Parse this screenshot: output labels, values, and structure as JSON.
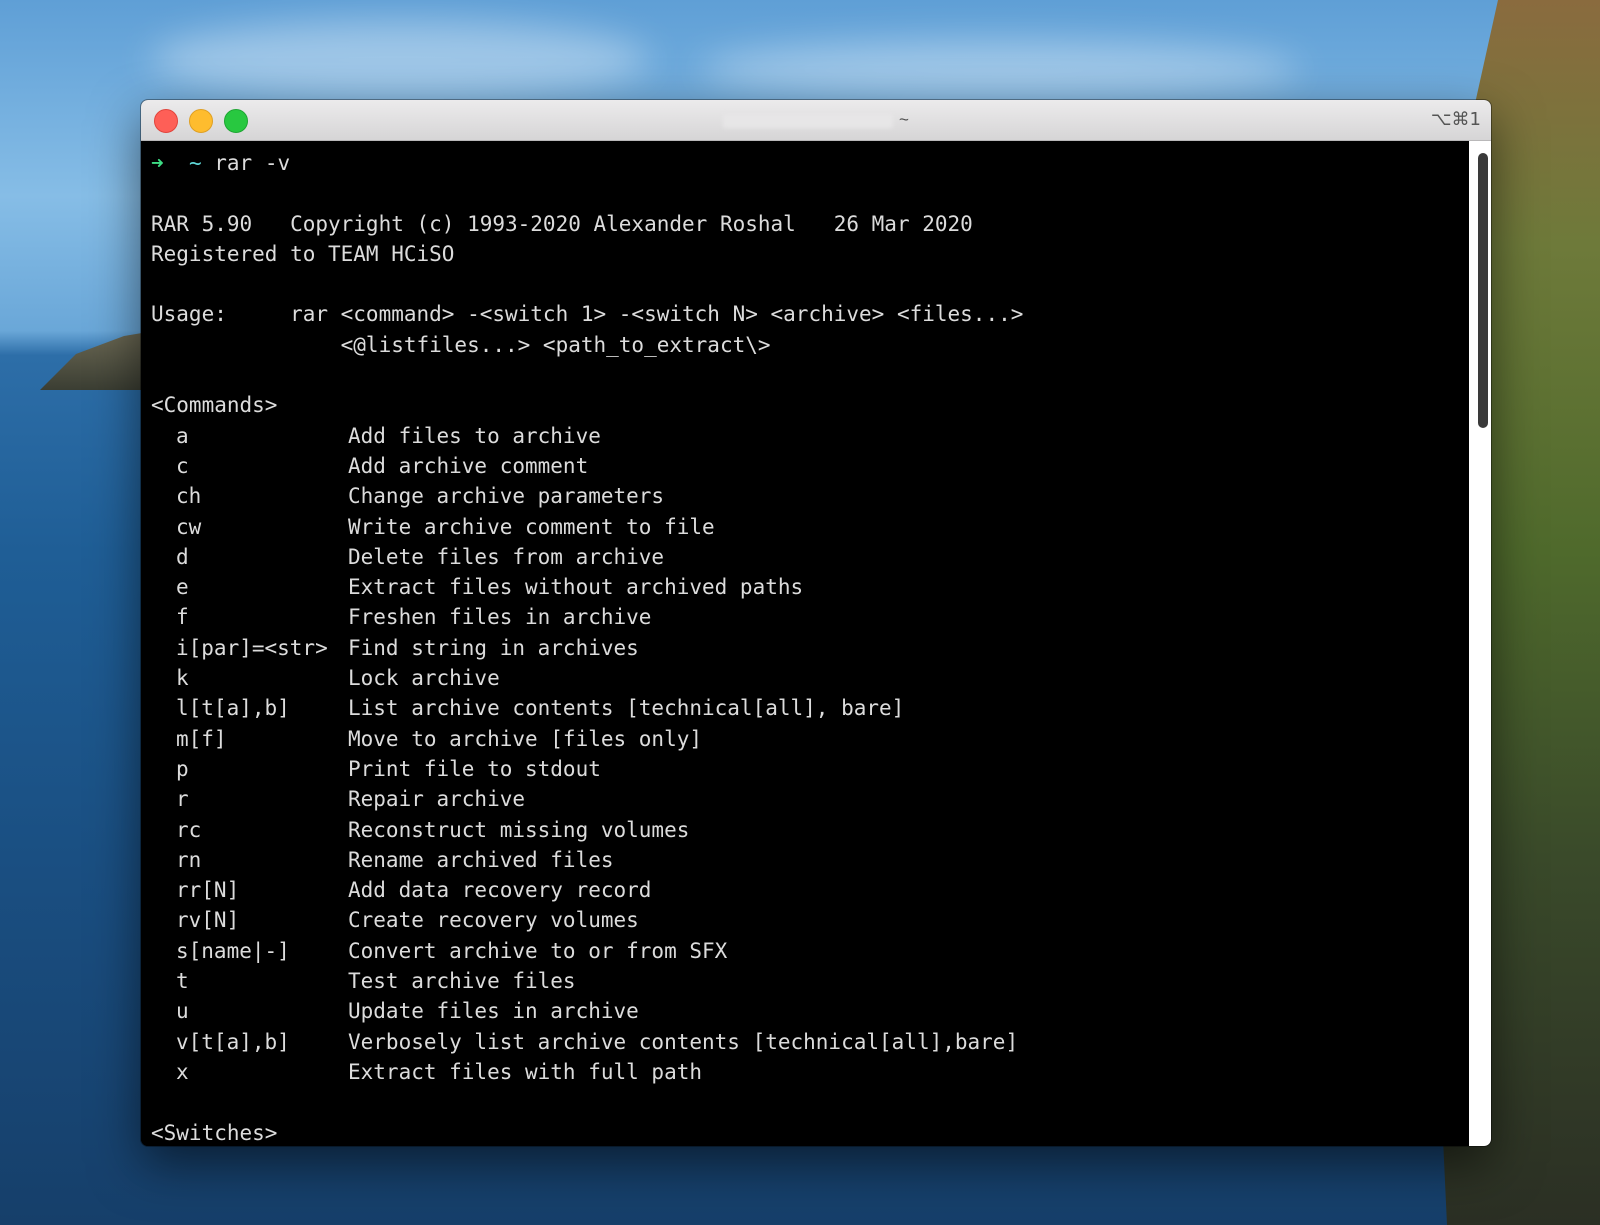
{
  "window": {
    "title_suffix": "~",
    "shortcut": "⌥⌘1"
  },
  "terminal": {
    "prompt": {
      "arrow": "➜",
      "dir": "~",
      "command": "rar -v"
    },
    "header": [
      "RAR 5.90   Copyright (c) 1993-2020 Alexander Roshal   26 Mar 2020",
      "Registered to TEAM HCiSO"
    ],
    "usage": [
      "Usage:     rar <command> -<switch 1> -<switch N> <archive> <files...>",
      "               <@listfiles...> <path_to_extract\\>"
    ],
    "commands_heading": "<Commands>",
    "commands": [
      {
        "name": "a",
        "desc": "Add files to archive"
      },
      {
        "name": "c",
        "desc": "Add archive comment"
      },
      {
        "name": "ch",
        "desc": "Change archive parameters"
      },
      {
        "name": "cw",
        "desc": "Write archive comment to file"
      },
      {
        "name": "d",
        "desc": "Delete files from archive"
      },
      {
        "name": "e",
        "desc": "Extract files without archived paths"
      },
      {
        "name": "f",
        "desc": "Freshen files in archive"
      },
      {
        "name": "i[par]=<str>",
        "desc": "Find string in archives"
      },
      {
        "name": "k",
        "desc": "Lock archive"
      },
      {
        "name": "l[t[a],b]",
        "desc": "List archive contents [technical[all], bare]"
      },
      {
        "name": "m[f]",
        "desc": "Move to archive [files only]"
      },
      {
        "name": "p",
        "desc": "Print file to stdout"
      },
      {
        "name": "r",
        "desc": "Repair archive"
      },
      {
        "name": "rc",
        "desc": "Reconstruct missing volumes"
      },
      {
        "name": "rn",
        "desc": "Rename archived files"
      },
      {
        "name": "rr[N]",
        "desc": "Add data recovery record"
      },
      {
        "name": "rv[N]",
        "desc": "Create recovery volumes"
      },
      {
        "name": "s[name|-]",
        "desc": "Convert archive to or from SFX"
      },
      {
        "name": "t",
        "desc": "Test archive files"
      },
      {
        "name": "u",
        "desc": "Update files in archive"
      },
      {
        "name": "v[t[a],b]",
        "desc": "Verbosely list archive contents [technical[all],bare]"
      },
      {
        "name": "x",
        "desc": "Extract files with full path"
      }
    ],
    "switches_heading": "<Switches>"
  }
}
